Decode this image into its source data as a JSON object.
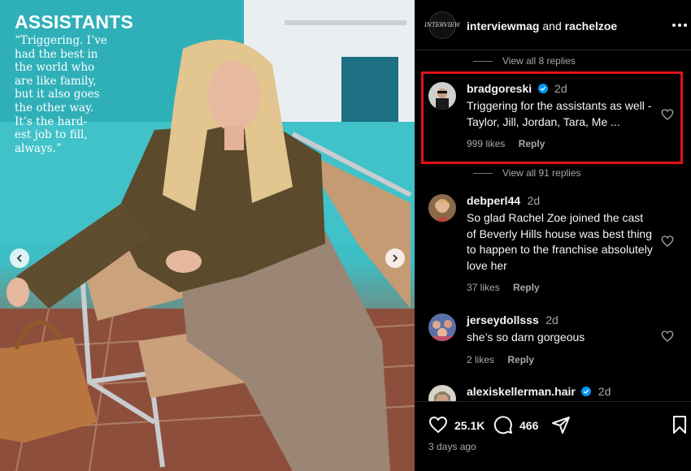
{
  "post": {
    "image": {
      "headline": "ASSISTANTS",
      "quote": "“Triggering. I’ve\nhad the best in\nthe world who\nare like family,\nbut it also goes\nthe other way.\nIt’s the hard-\nest job to fill,\nalways.”",
      "carousel_prev_icon": "chevron-left-icon",
      "carousel_next_icon": "chevron-right-icon"
    },
    "header": {
      "avatar_text": "INTERVIEW",
      "author": "interviewmag",
      "joiner": " and ",
      "coauthor": "rachelzoe",
      "more_icon": "more-horizontal-icon"
    },
    "replies_links": [
      "View all 8 replies",
      "View all 91 replies"
    ],
    "comments": [
      {
        "username": "bradgoreski",
        "verified": true,
        "time": "2d",
        "text": "Triggering for the assistants as well - Taylor, Jill, Jordan, Tara, Me ...",
        "likes": "999 likes",
        "reply": "Reply",
        "highlighted": true
      },
      {
        "username": "debperl44",
        "verified": false,
        "time": "2d",
        "text": "So glad Rachel Zoe joined the cast of Beverly Hills house was best thing to happen to the franchise absolutely love her",
        "likes": "37 likes",
        "reply": "Reply",
        "highlighted": false
      },
      {
        "username": "jerseydollsss",
        "verified": false,
        "time": "2d",
        "text": "she’s so darn gorgeous",
        "likes": "2 likes",
        "reply": "Reply",
        "highlighted": false
      },
      {
        "username": "alexiskellerman.hair",
        "verified": true,
        "time": "2d",
        "text": "",
        "likes": "",
        "reply": "",
        "highlighted": false
      }
    ],
    "actions": {
      "like_count": "25.1K",
      "comment_count": "466",
      "icons": [
        "heart-icon",
        "comment-icon",
        "share-icon",
        "bookmark-icon"
      ]
    },
    "timestamp": "3 days ago"
  },
  "colors": {
    "background": "#000000",
    "text": "#f5f5f5",
    "secondary_text": "#a8a8a8",
    "verified": "#0095f6",
    "highlight_border": "#e3121b"
  }
}
